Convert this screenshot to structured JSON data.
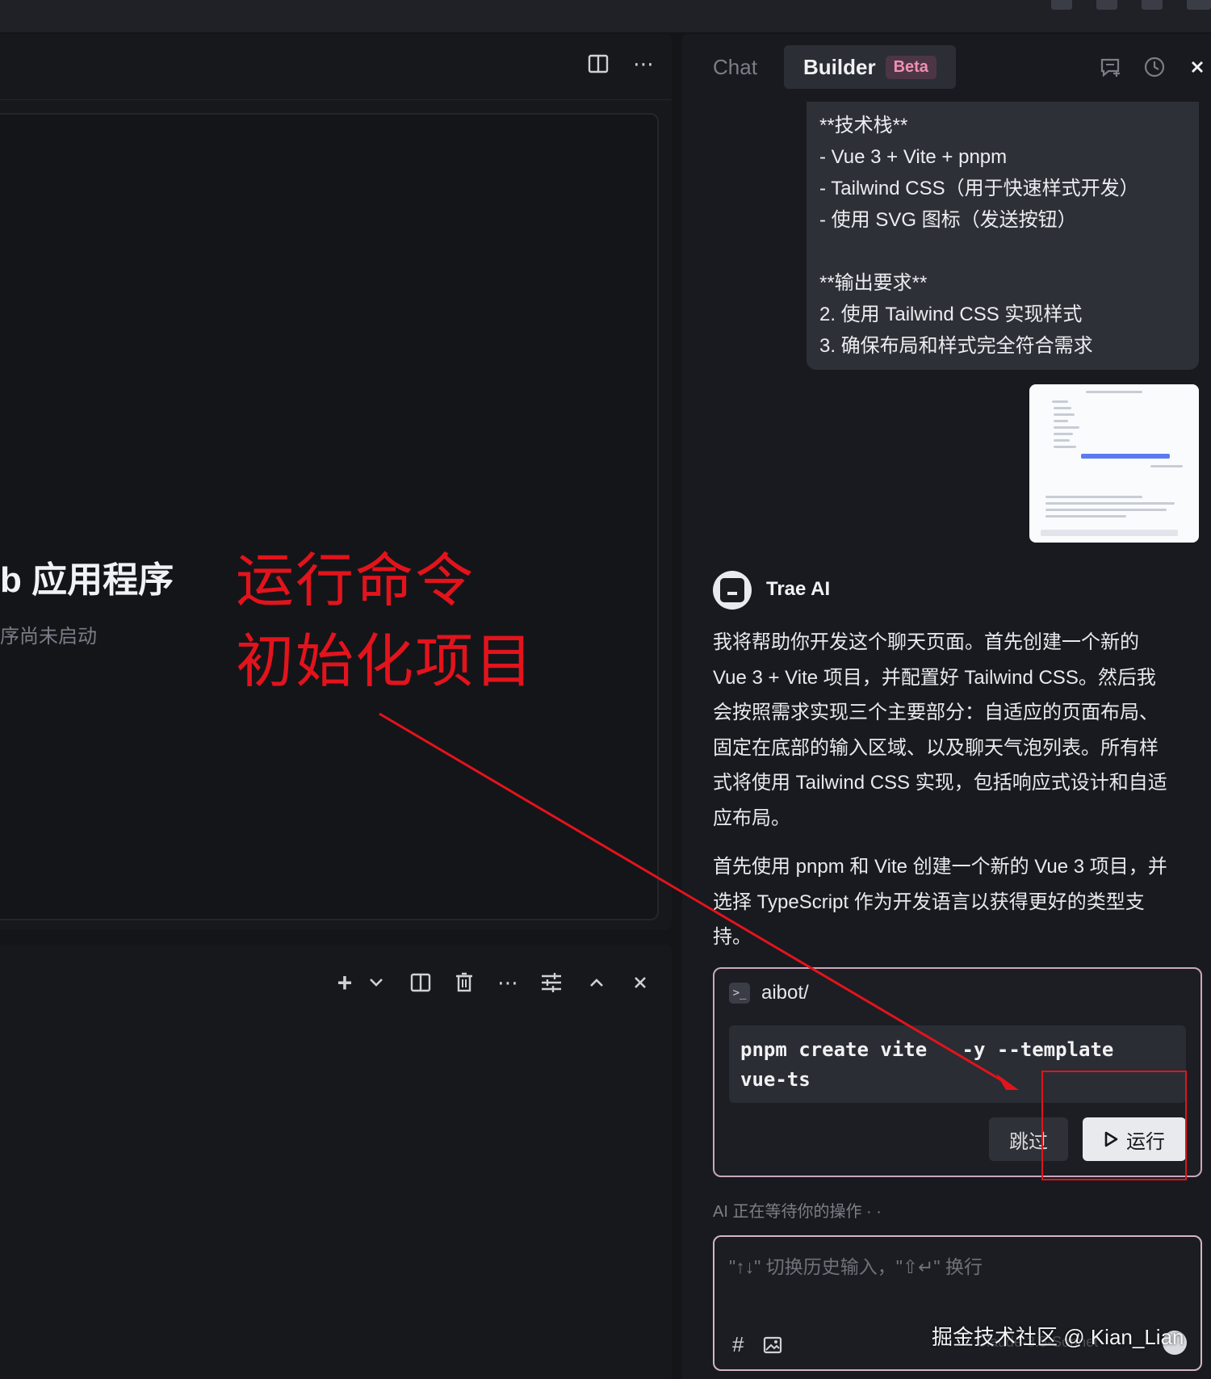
{
  "left_panel": {
    "app_title": "b 应用程序",
    "app_subtitle": "序尚未启动"
  },
  "annotation": {
    "line1": "运行命令",
    "line2": "初始化项目",
    "color": "#e3131c"
  },
  "right_panel": {
    "tabs": [
      {
        "label": "Chat"
      },
      {
        "label": "Builder",
        "badge": "Beta"
      }
    ],
    "user_message": {
      "lines": [
        "**技术栈**",
        "- Vue 3 + Vite + pnpm",
        "- Tailwind CSS（用于快速样式开发）",
        "- 使用 SVG 图标（发送按钮）",
        "",
        "**输出要求**",
        "2. 使用 Tailwind CSS 实现样式",
        "3. 确保布局和样式完全符合需求"
      ]
    },
    "ai": {
      "name": "Trae AI",
      "paragraph1": [
        "我将帮助你开发这个聊天页面。首先创建一个新的",
        "Vue 3 + Vite 项目，并配置好 Tailwind CSS。然后我",
        "会按照需求实现三个主要部分：自适应的页面布局、",
        "固定在底部的输入区域、以及聊天气泡列表。所有样",
        "式将使用 Tailwind CSS 实现，包括响应式设计和自适",
        "应布局。"
      ],
      "paragraph2": [
        "首先使用 pnpm 和 Vite 创建一个新的 Vue 3 项目，并",
        "选择 TypeScript 作为开发语言以获得更好的类型支",
        "持。"
      ]
    },
    "command": {
      "path": "aibot/",
      "code_lines": [
        "pnpm create vite   -y --template",
        "vue-ts"
      ],
      "skip_label": "跳过",
      "run_label": "运行"
    },
    "status": "AI 正在等待你的操作 · ·",
    "input": {
      "placeholder": "\"↑↓\" 切换历史输入，\"⇧↵\" 换行",
      "hash_label": "#",
      "model": "Claude-3.5-Sonnet"
    }
  },
  "watermark": "掘金技术社区 @ Kian_Lian",
  "colors": {
    "background": "#141519",
    "panel": "#181a1f",
    "accent_badge": "#f08fb1",
    "annotation_red": "#e3131c"
  }
}
